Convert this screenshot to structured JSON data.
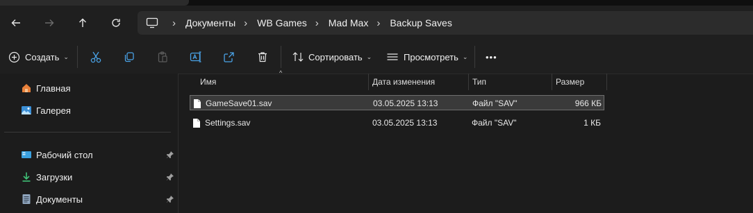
{
  "breadcrumbs": [
    "Документы",
    "WB Games",
    "Mad Max",
    "Backup Saves"
  ],
  "toolbar": {
    "create_label": "Создать",
    "sort_label": "Сортировать",
    "view_label": "Просмотреть",
    "more_label": "•••"
  },
  "sidebar": {
    "top_items": [
      {
        "label": "Главная",
        "icon": "home-icon"
      },
      {
        "label": "Галерея",
        "icon": "gallery-icon"
      }
    ],
    "pinned_items": [
      {
        "label": "Рабочий стол",
        "icon": "desktop-icon"
      },
      {
        "label": "Загрузки",
        "icon": "downloads-icon"
      },
      {
        "label": "Документы",
        "icon": "documents-icon"
      }
    ]
  },
  "columns": {
    "name": "Имя",
    "date": "Дата изменения",
    "type": "Тип",
    "size": "Размер"
  },
  "files": [
    {
      "name": "GameSave01.sav",
      "date": "03.05.2025 13:13",
      "type": "Файл \"SAV\"",
      "size": "966 КБ",
      "selected": true
    },
    {
      "name": "Settings.sav",
      "date": "03.05.2025 13:13",
      "type": "Файл \"SAV\"",
      "size": "1 КБ",
      "selected": false
    }
  ],
  "colors": {
    "background": "#1c1c1c",
    "accent_blue": "#4aa3e8",
    "home_orange": "#e8803a",
    "downloads_green": "#3fc177"
  }
}
